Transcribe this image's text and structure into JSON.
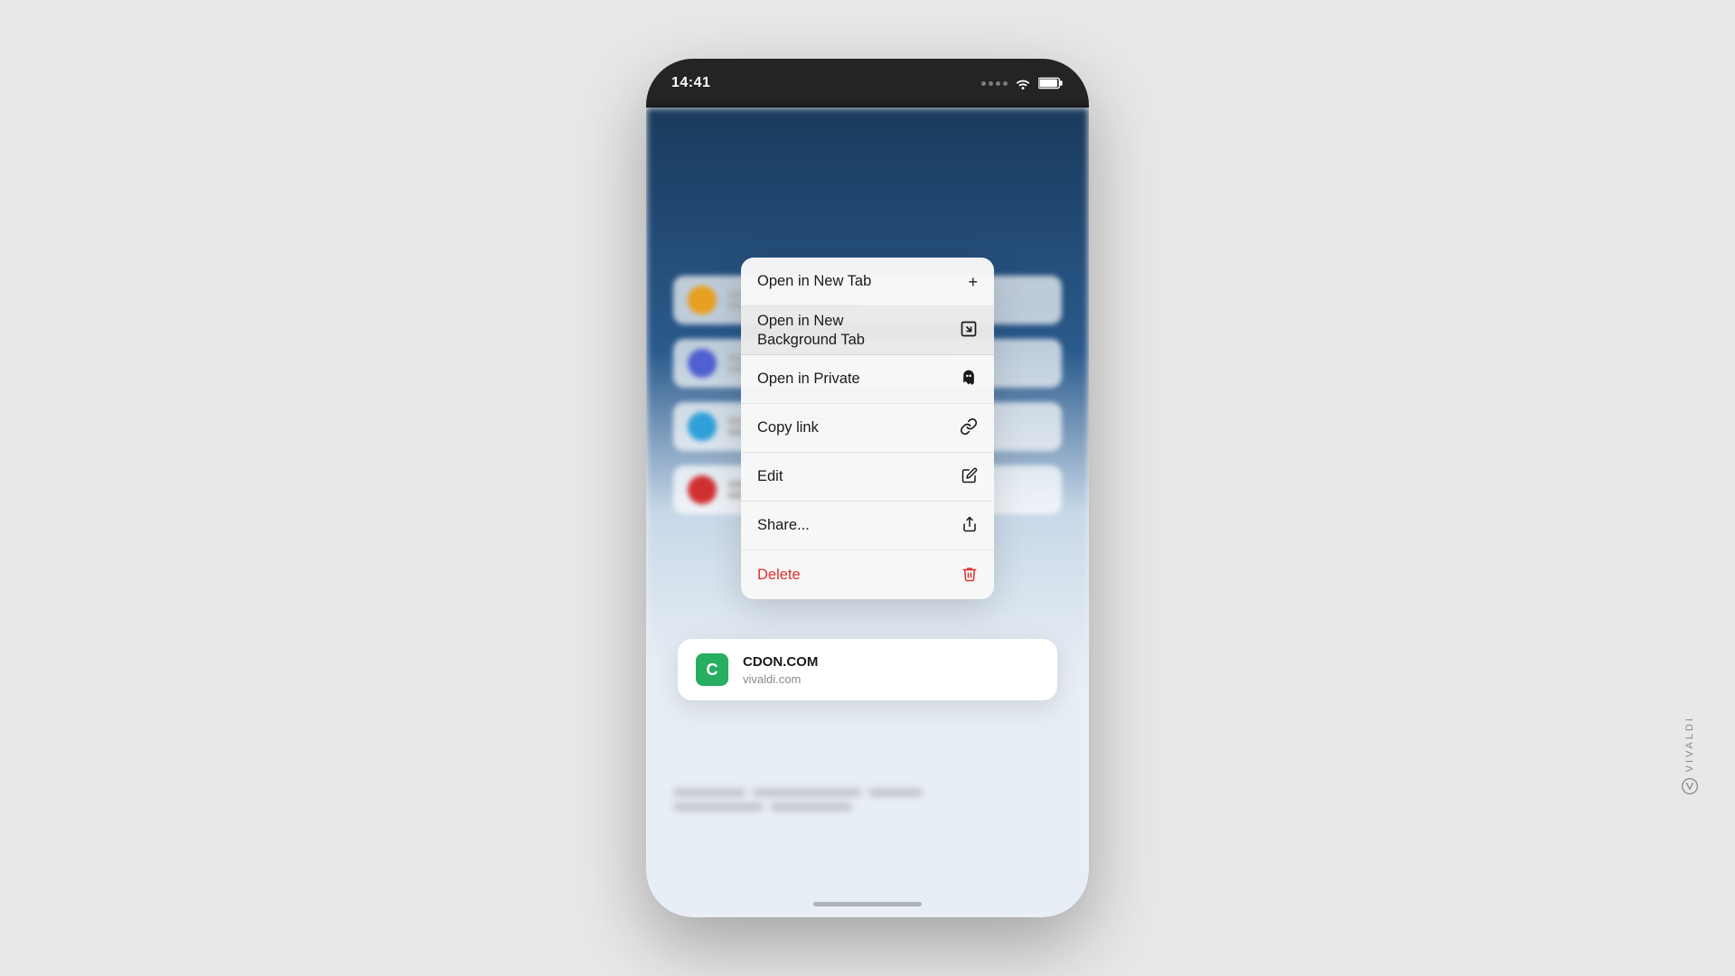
{
  "page": {
    "background_color": "#e8e8e8"
  },
  "phone": {
    "status_bar": {
      "time": "14:41"
    }
  },
  "context_menu": {
    "items": [
      {
        "id": "open-new-tab",
        "label": "Open in New Tab",
        "icon": "+",
        "highlighted": false,
        "delete": false
      },
      {
        "id": "open-bg-tab",
        "label": "Open in New\nBackground Tab",
        "icon": "⊞",
        "highlighted": true,
        "delete": false
      },
      {
        "id": "open-private",
        "label": "Open in Private",
        "icon": "👻",
        "highlighted": false,
        "delete": false
      },
      {
        "id": "copy-link",
        "label": "Copy link",
        "icon": "🔗",
        "highlighted": false,
        "delete": false
      },
      {
        "id": "edit",
        "label": "Edit",
        "icon": "✏",
        "highlighted": false,
        "delete": false
      },
      {
        "id": "share",
        "label": "Share...",
        "icon": "⬆",
        "highlighted": false,
        "delete": false
      },
      {
        "id": "delete",
        "label": "Delete",
        "icon": "🗑",
        "highlighted": false,
        "delete": true
      }
    ]
  },
  "url_preview": {
    "favicon_letter": "C",
    "title": "CDON.COM",
    "domain": "vivaldi.com"
  },
  "vivaldi": {
    "text": "VIVALDI"
  }
}
